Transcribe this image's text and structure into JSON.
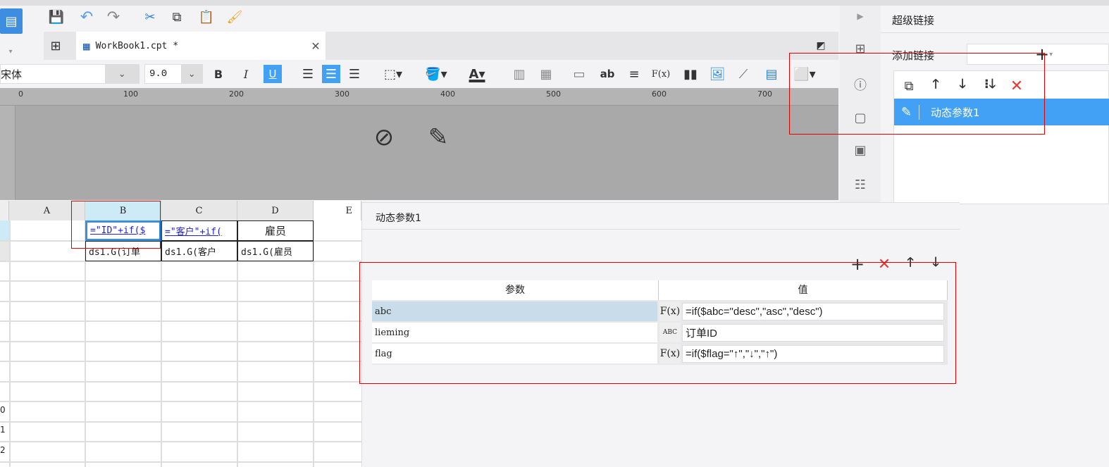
{
  "toolbar": {
    "icons": [
      "app-logo",
      "save",
      "undo",
      "redo",
      "cut",
      "copy",
      "paste",
      "format-painter"
    ]
  },
  "tabs": [
    {
      "label": "WorkBook1.cpt *",
      "active": true
    }
  ],
  "format": {
    "font": "宋体",
    "size": "9.0",
    "bold": "B",
    "italic": "I",
    "underline": "U",
    "formula_label": "F(x)",
    "text_label": "ab"
  },
  "ruler": {
    "ticks": [
      "0",
      "100",
      "200",
      "300",
      "400",
      "500",
      "600",
      "700"
    ]
  },
  "grid": {
    "columns": [
      "A",
      "B",
      "C",
      "D",
      "E"
    ],
    "row_labels": [
      "0",
      "1",
      "2"
    ],
    "cells": {
      "B1": "=\"ID\"+if($",
      "C1": "=\"客户\"+if(",
      "D1": "雇员",
      "B2": "ds1.G(订单",
      "C2": "ds1.G(客户",
      "D2": "ds1.G(雇员"
    }
  },
  "hyperlink_panel": {
    "title": "超级链接",
    "add_label": "添加链接",
    "items": [
      {
        "label": "动态参数1",
        "selected": true
      }
    ]
  },
  "dialog": {
    "title": "动态参数1",
    "headers": [
      "参数",
      "值"
    ],
    "rows": [
      {
        "name": "abc",
        "type": "formula",
        "type_label": "F(x)",
        "value": "=if($abc=\"desc\",\"asc\",\"desc\")",
        "selected": true
      },
      {
        "name": "lieming",
        "type": "string",
        "type_label": "ABC",
        "value": "订单ID"
      },
      {
        "name": "flag",
        "type": "formula",
        "type_label": "F(x)",
        "value": "=if($flag=\"↑\",\"↓\",\"↑\")"
      }
    ]
  },
  "colors": {
    "accent": "#42a0f5",
    "selected_row": "#c8dcea",
    "highlight_box": "#e00000",
    "delete": "#e53935"
  }
}
